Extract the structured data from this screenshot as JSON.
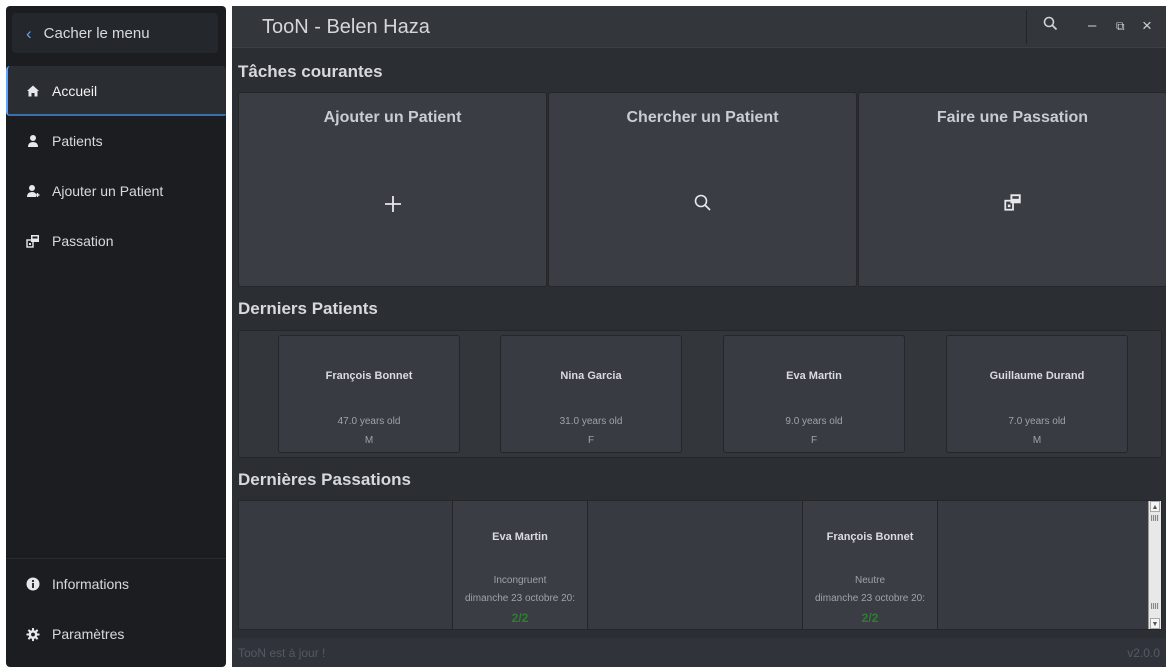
{
  "sidebar": {
    "hide_menu_label": "Cacher le menu",
    "items": [
      {
        "label": "Accueil",
        "icon": "home-icon",
        "active": true
      },
      {
        "label": "Patients",
        "icon": "user-icon"
      },
      {
        "label": "Ajouter un Patient",
        "icon": "add-user-icon"
      },
      {
        "label": "Passation",
        "icon": "passation-icon"
      }
    ],
    "bottom_items": [
      {
        "label": "Informations",
        "icon": "info-icon"
      },
      {
        "label": "Paramètres",
        "icon": "gear-icon"
      }
    ]
  },
  "window": {
    "title": "TooN - Belen Haza",
    "search_icon": "search-icon",
    "minimize_glyph": "–",
    "restore_glyph": "⧉",
    "close_glyph": "×"
  },
  "tasks": {
    "title": "Tâches courantes",
    "cards": [
      {
        "label": "Ajouter un Patient",
        "icon": "plus-icon"
      },
      {
        "label": "Chercher un Patient",
        "icon": "search-icon"
      },
      {
        "label": "Faire une Passation",
        "icon": "passation-icon"
      }
    ]
  },
  "recent_patients": {
    "title": "Derniers Patients",
    "patients": [
      {
        "name": "François Bonnet",
        "age": "47.0 years old",
        "sex": "M"
      },
      {
        "name": "Nina Garcia",
        "age": "31.0 years old",
        "sex": "F"
      },
      {
        "name": "Eva Martin",
        "age": "9.0 years old",
        "sex": "F"
      },
      {
        "name": "Guillaume Durand",
        "age": "7.0 years old",
        "sex": "M"
      }
    ]
  },
  "recent_passations": {
    "title": "Dernières Passations",
    "items": [
      {
        "name": "Eva Martin",
        "type": "Incongruent",
        "date": "dimanche 23 octobre 20:",
        "score": "2/2"
      },
      {
        "name": "François Bonnet",
        "type": "Neutre",
        "date": "dimanche 23 octobre 20:",
        "score": "2/2"
      }
    ]
  },
  "status": {
    "text": "TooN est à jour !",
    "version": "v2.0.0"
  },
  "colors": {
    "accent": "#5ea4ff",
    "score": "#2f7d2f"
  }
}
